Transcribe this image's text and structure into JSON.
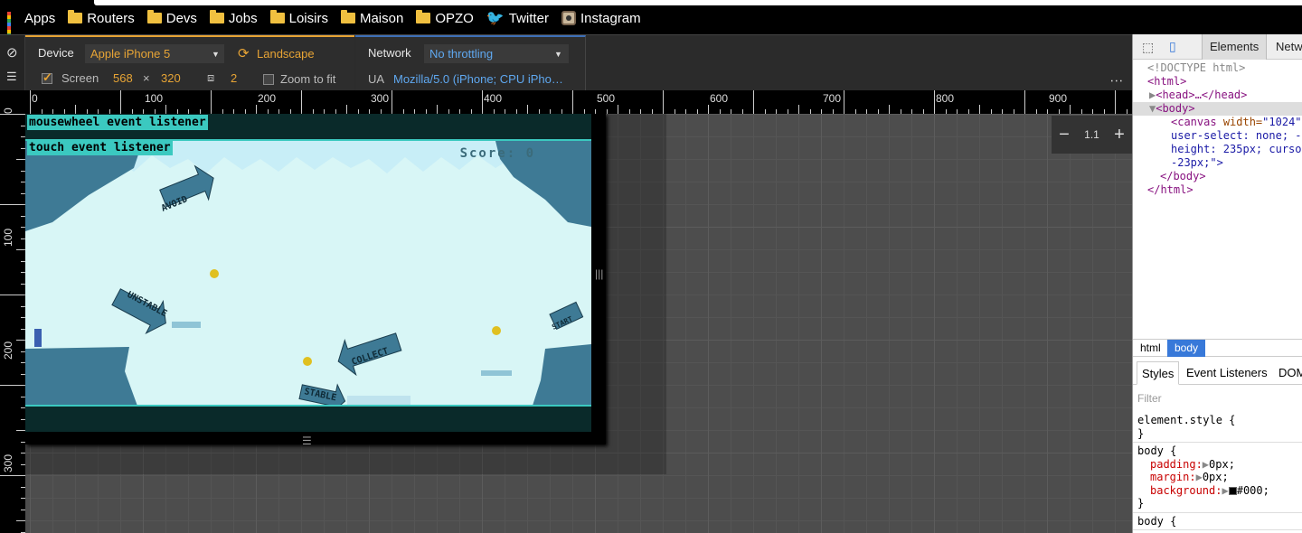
{
  "bookmarks": [
    {
      "label": "Apps",
      "icon": "apps-grid-icon"
    },
    {
      "label": "Routers",
      "icon": "folder-icon"
    },
    {
      "label": "Devs",
      "icon": "folder-icon"
    },
    {
      "label": "Jobs",
      "icon": "folder-icon"
    },
    {
      "label": "Loisirs",
      "icon": "folder-icon"
    },
    {
      "label": "Maison",
      "icon": "folder-icon"
    },
    {
      "label": "OPZO",
      "icon": "folder-icon"
    },
    {
      "label": "Twitter",
      "icon": "twitter-bird-icon"
    },
    {
      "label": "Instagram",
      "icon": "instagram-icon"
    }
  ],
  "device_toolbar": {
    "device_label": "Device",
    "device_value": "Apple iPhone 5",
    "orientation_label": "Landscape",
    "screen_label": "Screen",
    "screen_width": "568",
    "times": "×",
    "screen_height": "320",
    "pixel_ratio": "2",
    "zoom_to_fit_label": "Zoom to fit",
    "network_label": "Network",
    "network_value": "No throttling",
    "ua_label": "UA",
    "ua_value": "Mozilla/5.0 (iPhone; CPU iPho…",
    "more": "⋮"
  },
  "ruler_top": [
    "0",
    "100",
    "200",
    "300",
    "400",
    "500",
    "600",
    "700",
    "800",
    "900"
  ],
  "ruler_left": [
    "0",
    "100",
    "200",
    "300"
  ],
  "game": {
    "mousewheel_label": "mousewheel event listener",
    "touch_label": "touch event listener",
    "score": "Score: 0",
    "signs": [
      "AVOID",
      "UNSTABLE",
      "COLLECT",
      "STABLE",
      "START"
    ]
  },
  "zoom": {
    "minus": "−",
    "value": "1.1",
    "plus": "+"
  },
  "devtools": {
    "tabs": [
      "Elements",
      "Netw"
    ],
    "dom": {
      "doctype": "<!DOCTYPE html>",
      "html_open": "<html>",
      "head": "<head>…</head>",
      "body_open": "<body>",
      "canvas_line1_tag": "<canvas",
      "canvas_line1_attr": "width=",
      "canvas_line1_val": "\"1024\"",
      "canvas_line2": "user-select: none; -",
      "canvas_line3": "height: 235px; curso",
      "canvas_line4": "-23px;\">",
      "body_close": "</body>",
      "html_close": "</html>"
    },
    "breadcrumbs": [
      "html",
      "body"
    ],
    "style_tabs": [
      "Styles",
      "Event Listeners",
      "DOM"
    ],
    "filter_placeholder": "Filter",
    "rules": {
      "element_style": "element.style {",
      "close": "}",
      "body_sel": "body {",
      "padding_prop": "padding:",
      "padding_val": "0px;",
      "margin_prop": "margin:",
      "margin_val": "0px;",
      "background_prop": "background:",
      "background_val": "#000;",
      "body_sel2": "body {"
    }
  },
  "colors": {
    "accent_orange": "#e7a435",
    "accent_blue": "#5fa8f0",
    "game_cyan": "#3bc9c0"
  }
}
